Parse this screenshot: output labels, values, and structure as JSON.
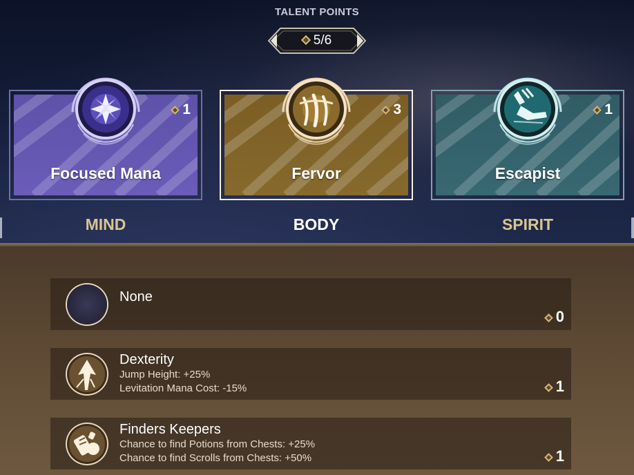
{
  "header": {
    "title": "TALENT POINTS",
    "points": "5/6"
  },
  "cards": [
    {
      "name": "Focused Mana",
      "cost": "1",
      "category": "MIND",
      "color": "#5b4fa6",
      "emblem": "star-burst-icon"
    },
    {
      "name": "Fervor",
      "cost": "3",
      "category": "BODY",
      "color": "#7a5f28",
      "emblem": "claw-slash-icon"
    },
    {
      "name": "Escapist",
      "cost": "1",
      "category": "SPIRIT",
      "color": "#34626a",
      "emblem": "winged-boot-icon"
    }
  ],
  "talents": [
    {
      "name": "None",
      "desc1": "",
      "desc2": "",
      "cost": "0",
      "icon": "empty-slot-icon"
    },
    {
      "name": "Dexterity",
      "desc1": "Jump Height: +25%",
      "desc2": "Levitation Mana Cost: -15%",
      "cost": "1",
      "icon": "upward-arrow-icon"
    },
    {
      "name": "Finders Keepers",
      "desc1": "Chance to find Potions from Chests: +25%",
      "desc2": "Chance to find Scrolls from Chests: +50%",
      "cost": "1",
      "icon": "scroll-potion-icon"
    }
  ],
  "colors": {
    "accent_gold": "#d9b774",
    "category_inactive": "#d8c592",
    "category_active": "#ffffff"
  }
}
